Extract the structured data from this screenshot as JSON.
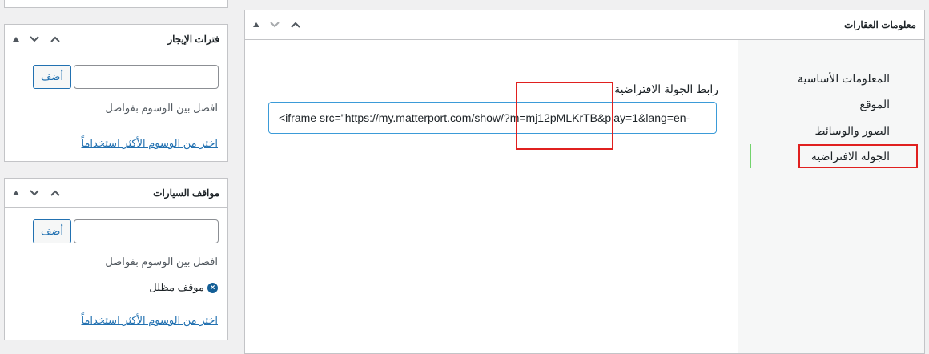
{
  "left_boxes": [
    {
      "title": "فترات الإيجار",
      "add_label": "أضف",
      "input_value": "",
      "hint": "افصل بين الوسوم بفواصل",
      "choose_link": "اختر من الوسوم الأكثر استخداماً",
      "tags": []
    },
    {
      "title": "مواقف السيارات",
      "add_label": "أضف",
      "input_value": "",
      "hint": "افصل بين الوسوم بفواصل",
      "choose_link": "اختر من الوسوم الأكثر استخداماً",
      "tags": [
        "موقف مظلل"
      ]
    }
  ],
  "main_box": {
    "title": "معلومات العقارات",
    "tabs": [
      {
        "label": "المعلومات الأساسية",
        "active": false
      },
      {
        "label": "الموقع",
        "active": false
      },
      {
        "label": "الصور والوسائط",
        "active": false
      },
      {
        "label": "الجولة الافتراضية",
        "active": true
      }
    ],
    "field_label": "رابط الجولة الافتراضية",
    "field_value": "<iframe src=\"https://my.matterport.com/show/?m=mj12pMLKrTB&play=1&lang=en-"
  },
  "highlight_color": "#e0201f",
  "link_color": "#2271b1",
  "icons": [
    "arrow-up-icon",
    "arrow-down-icon",
    "toggle-triangle-icon",
    "remove-tag-icon"
  ]
}
